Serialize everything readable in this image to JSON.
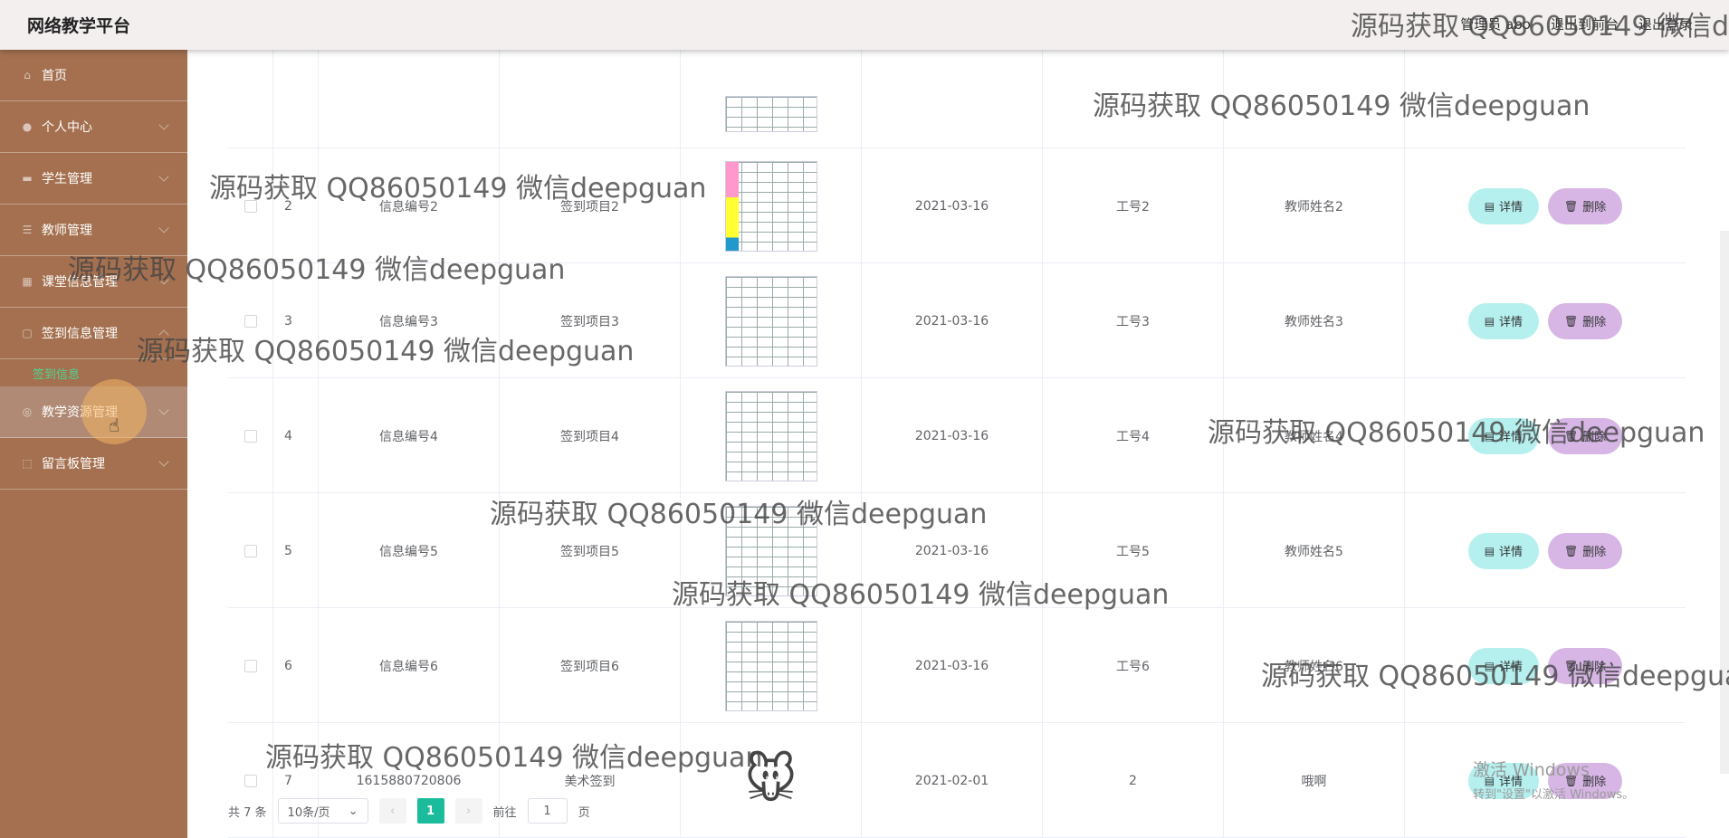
{
  "header": {
    "title": "网络教学平台",
    "role_label": "管理员 abo",
    "front_link": "退出到前台",
    "logout": "退出登录"
  },
  "sidebar": {
    "items": [
      {
        "label": "首页",
        "icon": "home-icon"
      },
      {
        "label": "个人中心",
        "icon": "user-icon"
      },
      {
        "label": "学生管理",
        "icon": "student-icon"
      },
      {
        "label": "教师管理",
        "icon": "teacher-icon"
      },
      {
        "label": "课堂信息管理",
        "icon": "class-icon"
      },
      {
        "label": "签到信息管理",
        "icon": "checkin-icon"
      },
      {
        "label": "教学资源管理",
        "icon": "resource-icon"
      },
      {
        "label": "留言板管理",
        "icon": "message-icon"
      }
    ],
    "sub_item": "签到信息"
  },
  "table": {
    "rows": [
      {
        "idx": "2",
        "no": "信息编号2",
        "name": "签到项目2",
        "date": "2021-03-16",
        "gh": "工号2",
        "teacher": "教师姓名2",
        "img": "thumbnail-schedule-color"
      },
      {
        "idx": "3",
        "no": "信息编号3",
        "name": "签到项目3",
        "date": "2021-03-16",
        "gh": "工号3",
        "teacher": "教师姓名3",
        "img": "thumbnail-schedule"
      },
      {
        "idx": "4",
        "no": "信息编号4",
        "name": "签到项目4",
        "date": "2021-03-16",
        "gh": "工号4",
        "teacher": "教师姓名4",
        "img": "thumbnail-schedule"
      },
      {
        "idx": "5",
        "no": "信息编号5",
        "name": "签到项目5",
        "date": "2021-03-16",
        "gh": "工号5",
        "teacher": "教师姓名5",
        "img": "thumbnail-schedule"
      },
      {
        "idx": "6",
        "no": "信息编号6",
        "name": "签到项目6",
        "date": "2021-03-16",
        "gh": "工号6",
        "teacher": "教师姓名6",
        "img": "thumbnail-schedule"
      },
      {
        "idx": "7",
        "no": "1615880720806",
        "name": "美术签到",
        "date": "2021-02-01",
        "gh": "2",
        "teacher": "哦啊",
        "img": "thumbnail-mouse-cartoon"
      }
    ],
    "detail_label": "详情",
    "delete_label": "删除"
  },
  "pager": {
    "total": "共 7 条",
    "page_size": "10条/页",
    "current_page": "1",
    "goto_prefix": "前往",
    "goto_value": "1",
    "goto_suffix": "页"
  },
  "watermark": {
    "text": "源码获取 QQ86050149 微信deepguan"
  },
  "windows_notice": {
    "line1": "激活 Windows",
    "line2": "转到\"设置\"以激活 Windows。"
  }
}
